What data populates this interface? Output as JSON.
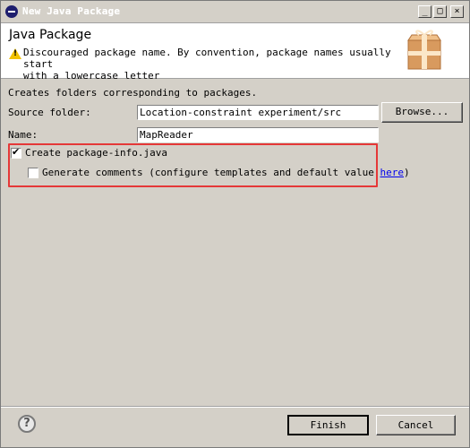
{
  "window": {
    "title": "New Java Package",
    "controls": {
      "minimize": "_",
      "maximize": "□",
      "close": "×"
    }
  },
  "header": {
    "title": "Java Package",
    "message_line1": "Discouraged package name. By convention, package names usually start",
    "message_line2": "with a lowercase letter",
    "warning_icon": "warning-triangle-icon",
    "banner_icon": "package-box-icon"
  },
  "form": {
    "description": "Creates folders corresponding to packages.",
    "source_folder_label": "Source folder:",
    "source_folder_value": "Location-constraint experiment/src",
    "browse_label": "Browse...",
    "name_label": "Name:",
    "name_value": "MapReader",
    "create_package_info_label": "Create package-info.java",
    "create_package_info_checked": true,
    "generate_comments_label": "Generate comments (configure templates and default value ",
    "generate_comments_link": "here",
    "generate_comments_suffix": ")",
    "generate_comments_checked": false
  },
  "footer": {
    "help_icon": "help-icon",
    "help_glyph": "?",
    "finish_label": "Finish",
    "cancel_label": "Cancel"
  },
  "colors": {
    "highlight": "#e53838",
    "link": "#0000ee",
    "dialog_bg": "#d4d0c8"
  }
}
